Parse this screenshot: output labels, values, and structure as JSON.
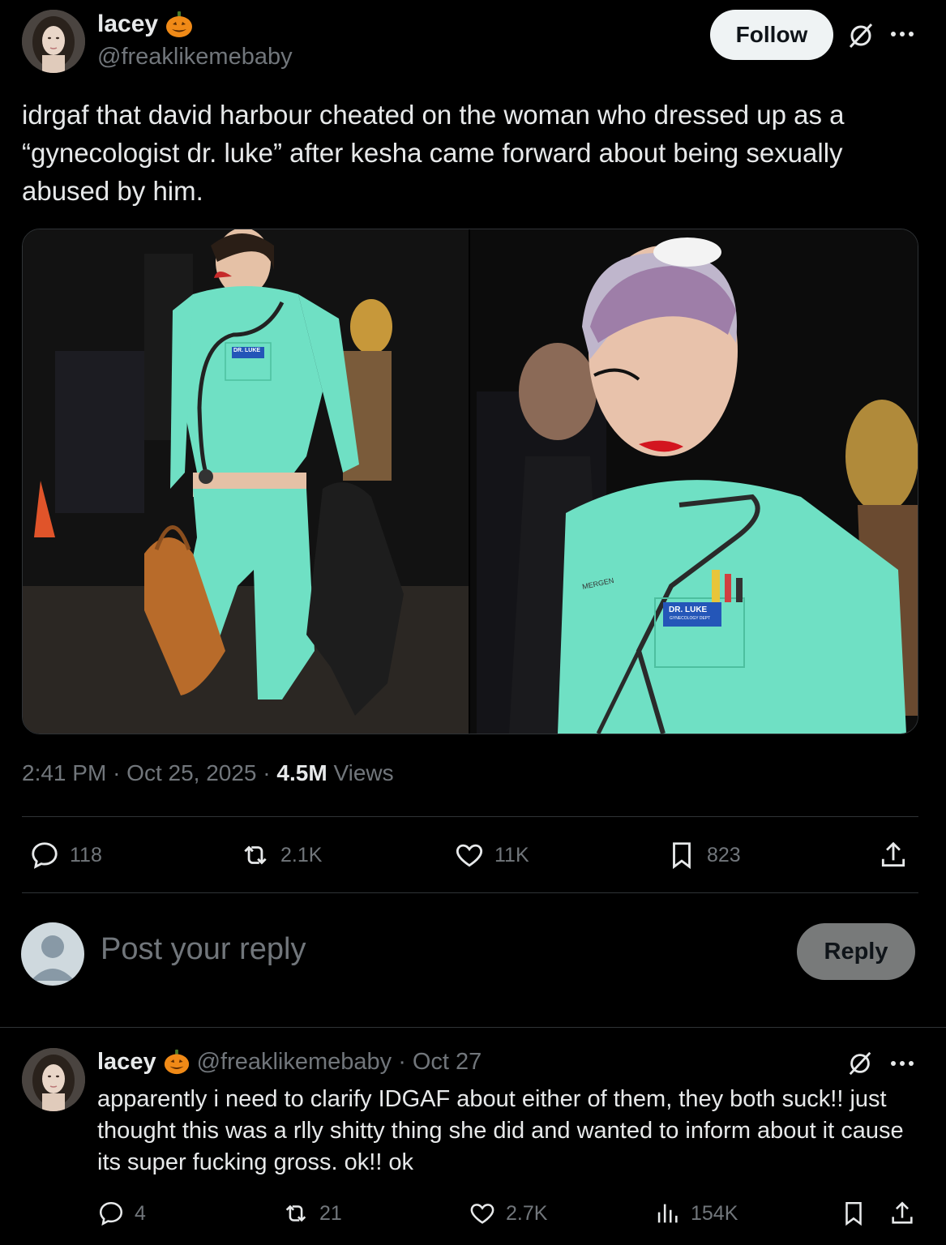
{
  "tweet": {
    "author": {
      "name": "lacey",
      "handle": "@freaklikemebaby",
      "badge_icon": "pumpkin-emoji"
    },
    "follow_label": "Follow",
    "text": "idrgaf that david harbour cheated on the woman who dressed up as a “gynecologist dr. luke” after kesha came forward about being sexually abused by him.",
    "media": {
      "left_tag": "DR. LUKE",
      "right_tag": "DR. LUKE",
      "right_tag_sub": "GYNECOLOGY DEPT",
      "right_pocket_text": "MERGEN"
    },
    "time": "2:41 PM",
    "date": "Oct 25, 2025",
    "views_count": "4.5M",
    "views_label": "Views",
    "stats": {
      "replies": "118",
      "reposts": "2.1K",
      "likes": "11K",
      "bookmarks": "823"
    }
  },
  "composer": {
    "placeholder": "Post your reply",
    "reply_label": "Reply"
  },
  "reply": {
    "name": "lacey",
    "handle": "@freaklikemebaby",
    "date": "Oct 27",
    "text": "apparently i need to clarify IDGAF about either of them, they both suck!! just thought this was a rlly shitty thing she did and wanted to inform about it cause its super fucking gross. ok!! ok",
    "stats": {
      "replies": "4",
      "reposts": "21",
      "likes": "2.7K",
      "views": "154K"
    }
  },
  "colors": {
    "background": "#000000",
    "text": "#e7e9ea",
    "muted": "#71767b",
    "divider": "#2f3336",
    "scrubs": "#6fe0c4"
  }
}
